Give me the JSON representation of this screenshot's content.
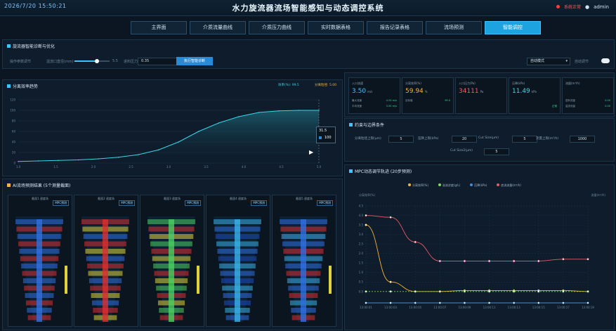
{
  "header": {
    "datetime": "2026/7/20 15:50:21",
    "title": "水力旋流器流场智能感知与动态调控系统",
    "status": "系统正常",
    "user": "admin"
  },
  "nav": {
    "tabs": [
      "主界面",
      "介质流量曲线",
      "介质压力曲线",
      "实时数据表格",
      "报告记录表格",
      "流场预测",
      "智能调控"
    ],
    "active_index": 6
  },
  "colors": {
    "accent": "#1da3e0",
    "curve": "#39d6e8",
    "orange": "#f5b43c",
    "red": "#e85a6a",
    "green": "#7ed957",
    "blue": "#3a8fe0"
  },
  "controls": {
    "section_title": "旋流器智能诊断与优化",
    "label1": "操作参数调节",
    "slider_label": "溢流口直径(mm)",
    "slider_value": "5.5",
    "slider_fraction": 0.63,
    "label2": "进料压力",
    "input_value": "0.35",
    "run_button": "执行智能诊断",
    "mode_select": "自动模式",
    "toggle_label": "自动调节"
  },
  "left_chart": {
    "title": "分离效率趋势",
    "legend_a": "效率(%): 99.5",
    "legend_b": "分离粒径: 5.00",
    "tooltip_title": "31.5",
    "tooltip_value": "100"
  },
  "metrics": [
    {
      "label": "入口流速",
      "value": "3.50",
      "unit": "m/s",
      "color": "#3cc4ff",
      "sub1": "最大流速",
      "sub1v": "4.25 m/s",
      "sub2": "平均流速",
      "sub2v": "3.50 m/s"
    },
    {
      "label": "分离效率(%)",
      "value": "59.94",
      "unit": "%",
      "color": "#f5b43c",
      "sub1": "目标值",
      "sub1v": "99.0",
      "sub2": "",
      "sub2v": ""
    },
    {
      "label": "入口压力(Pa)",
      "value": "34111",
      "unit": "Pa",
      "color": "#ff5a5a",
      "sub1": "",
      "sub1v": "",
      "sub2": "",
      "sub2v": ""
    },
    {
      "label": "压降(kPa)",
      "value": "11.49",
      "unit": "kPa",
      "color": "#39d6e8",
      "sub1": "",
      "sub1v": "",
      "sub2": "",
      "sub2v": "正常"
    },
    {
      "label": "流量(m³/h)",
      "value": "",
      "unit": "",
      "color": "#39d6e8",
      "sub1": "进料流量",
      "sub1v": "0.00",
      "sub2": "溢流流量",
      "sub2v": "0.00"
    }
  ],
  "param_panel": {
    "title": "约束与边界条件",
    "fields": [
      {
        "label": "分离粒径上限(μm)",
        "value": "5"
      },
      {
        "label": "压降上限(kPa)",
        "value": "20"
      },
      {
        "label": "Cut Size(μm)",
        "value": "5"
      },
      {
        "label": "流量上限(m³/h)",
        "value": "1000"
      },
      {
        "label": "Cut Size2(μm)",
        "value": "5"
      }
    ]
  },
  "sim_panel": {
    "title": "AI流场预测结果 (5个测量截面)",
    "slots": [
      {
        "title": "截面1 速度场",
        "tag": "MPC预测"
      },
      {
        "title": "截面2 速度场",
        "tag": "MPC预测"
      },
      {
        "title": "截面3 速度场",
        "tag": "MPC预测"
      },
      {
        "title": "截面4 速度场",
        "tag": "MPC预测"
      },
      {
        "title": "截面5 速度场",
        "tag": "MPC预测"
      }
    ]
  },
  "mpc": {
    "title": "MPC动态调节轨迹 (20步预测)",
    "legend": [
      "分离效率(%)",
      "溢流浓度(g/L)",
      "压降(kPa)",
      "底流流量(m³/h)"
    ],
    "left_axis_label": "分离效率(%)",
    "right_axis_label": "流量(m³/h)"
  },
  "chart_data": [
    {
      "type": "area",
      "title": "分离效率趋势",
      "x": [
        "0.0",
        "0.2",
        "0.4",
        "0.6",
        "0.8",
        "1.0",
        "1.2",
        "1.4",
        "1.6",
        "1.8",
        "2.0",
        "2.2",
        "2.4",
        "2.6",
        "2.8",
        "3.0"
      ],
      "xticks": [
        "1.0",
        "1.5",
        "2.0",
        "2.5",
        "3.0",
        "3.5",
        "4.0",
        "4.5",
        "5.0"
      ],
      "values": [
        3,
        4,
        5,
        6,
        8,
        11,
        16,
        25,
        40,
        60,
        76,
        88,
        96,
        99,
        100,
        100
      ],
      "yticks": [
        "0",
        "20",
        "40",
        "60",
        "80",
        "100",
        "120"
      ],
      "ylim": [
        0,
        120
      ]
    },
    {
      "type": "line",
      "title": "MPC动态调节轨迹 (20步预测)",
      "x": [
        "13:00:01",
        "13:00:03",
        "13:00:05",
        "13:00:07",
        "13:00:09",
        "13:00:11",
        "13:00:13",
        "13:00:15",
        "13:00:17",
        "13:00:19"
      ],
      "series": [
        {
          "name": "分离效率(%)",
          "color": "#f5b43c",
          "values": [
            3.5,
            0.5,
            0.0,
            0.0,
            0.05,
            0.05,
            0.05,
            0.05,
            0.05,
            0.0
          ]
        },
        {
          "name": "溢流浓度(g/L)",
          "color": "#7ed957",
          "values": [
            0.0,
            0.0,
            0.0,
            0.0,
            0.0,
            0.0,
            0.0,
            0.0,
            0.0,
            0.0
          ]
        },
        {
          "name": "压降(kPa)",
          "color": "#3a8fe0",
          "values": [
            -0.6,
            -0.6,
            -0.6,
            -0.6,
            -0.6,
            -0.6,
            -0.6,
            -0.6,
            -0.6,
            -0.6
          ]
        },
        {
          "name": "底流流量(m³/h)",
          "color": "#e85a6a",
          "values": [
            4.0,
            3.9,
            2.6,
            1.6,
            1.6,
            1.6,
            1.6,
            1.6,
            1.7,
            1.7
          ]
        }
      ],
      "yticks": [
        "4.5",
        "4.0",
        "3.5",
        "3.0",
        "2.5",
        "2.0",
        "1.5",
        "1.0",
        "0.5",
        "0.0"
      ],
      "ylim": [
        -0.6,
        4.5
      ]
    }
  ]
}
